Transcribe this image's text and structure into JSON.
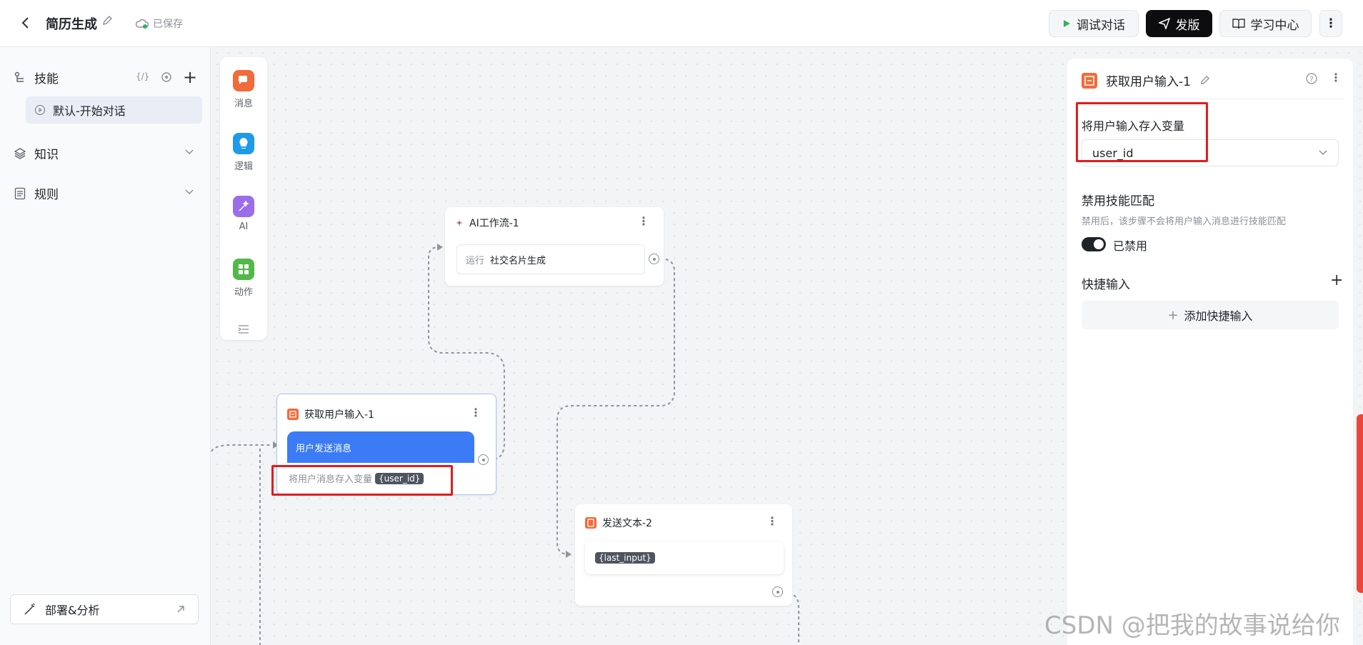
{
  "header": {
    "title": "简历生成",
    "saved_label": "已保存",
    "debug_label": "调试对话",
    "publish_label": "发版",
    "learn_label": "学习中心"
  },
  "sidebar": {
    "skills_label": "技能",
    "skills_code_label": "{/}",
    "skill_item_label": "默认-开始对话",
    "knowledge_label": "知识",
    "rules_label": "规则",
    "deploy_label": "部署&分析"
  },
  "palette": {
    "items": [
      {
        "label": "消息",
        "color": "#f26b3a"
      },
      {
        "label": "逻辑",
        "color": "#1e9be8"
      },
      {
        "label": "AI",
        "color": "#9a6ee8"
      },
      {
        "label": "动作",
        "color": "#52b84a"
      }
    ]
  },
  "nodes": {
    "ai_workflow": {
      "title": "AI工作流-1",
      "run_label": "运行",
      "run_value": "社交名片生成"
    },
    "get_input": {
      "title": "获取用户输入-1",
      "message_label": "用户发送消息",
      "store_label": "将用户消息存入变量",
      "var_chip": "{user_id}"
    },
    "send_text": {
      "title": "发送文本-2",
      "chip": "{last_input}"
    }
  },
  "panel": {
    "title": "获取用户输入-1",
    "store_var_label": "将用户输入存入变量",
    "store_var_value": "user_id",
    "disable_match_title": "禁用技能匹配",
    "disable_match_desc": "禁用后，该步骤不会将用户输入消息进行技能匹配",
    "toggle_label": "已禁用",
    "quick_input_title": "快捷输入",
    "add_quick_label": "添加快捷输入"
  },
  "watermark": "CSDN @把我的故事说给你",
  "colors": {
    "accent_blue": "#3b7bf6",
    "highlight_red": "#e31c1c",
    "brand_orange": "#f26b3a"
  }
}
